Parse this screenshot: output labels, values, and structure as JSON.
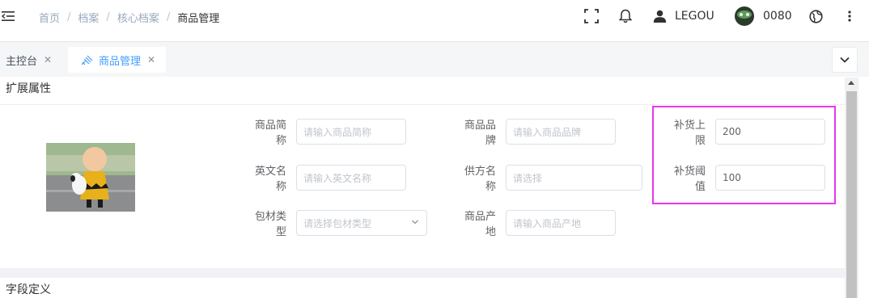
{
  "breadcrumb": [
    "首页",
    "档案",
    "核心档案",
    "商品管理"
  ],
  "breadcrumb_sep": "/",
  "header": {
    "user_name": "LEGOU",
    "account": "0080",
    "icons": [
      "fullscreen-icon",
      "bell-icon",
      "user-icon",
      "globe-icon",
      "more-vertical-icon"
    ]
  },
  "tags": [
    {
      "label": "主控台",
      "close": "✕",
      "active": false
    },
    {
      "label": "商品管理",
      "close": "✕",
      "active": true
    }
  ],
  "section_extended": {
    "title": "扩展属性",
    "fields": {
      "short_name": {
        "label": "商品简称",
        "placeholder": "请输入商品简称"
      },
      "brand": {
        "label": "商品品牌",
        "placeholder": "请输入商品品牌"
      },
      "restock_upper": {
        "label": "补货上限",
        "value": "200"
      },
      "english_name": {
        "label": "英文名称",
        "placeholder": "请输入英文名称"
      },
      "supplier": {
        "label": "供方名称",
        "placeholder": "请选择"
      },
      "restock_threshold": {
        "label": "补货阈值",
        "value": "100"
      },
      "packaging_type": {
        "label": "包材类型",
        "placeholder": "请选择包材类型"
      },
      "origin": {
        "label": "商品产地",
        "placeholder": "请输入商品产地"
      }
    }
  },
  "section_fields": {
    "title": "字段定义"
  },
  "colors": {
    "accent": "#409eff",
    "highlight": "#e935e9"
  }
}
